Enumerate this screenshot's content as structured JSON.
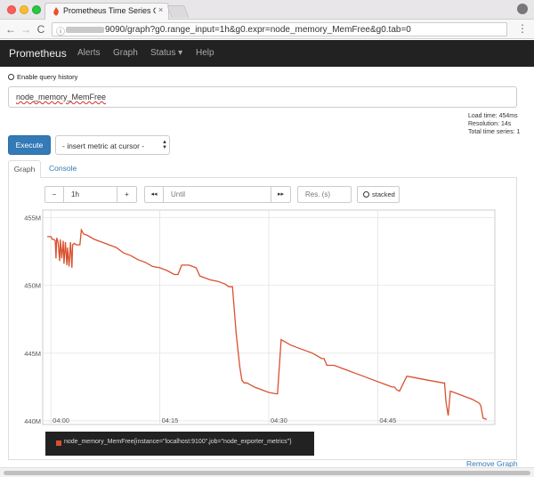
{
  "browser": {
    "tab_title": "Prometheus Time Series Colle",
    "url": "9090/graph?g0.range_input=1h&g0.expr=node_memory_MemFree&g0.tab=0",
    "back_glyph": "←",
    "forward_glyph": "→",
    "reload_glyph": "C",
    "info_glyph": "ⓘ",
    "star_glyph": "☆",
    "menu_glyph": "⋮",
    "close_glyph": "×"
  },
  "navbar": {
    "brand": "Prometheus",
    "links": [
      "Alerts",
      "Graph",
      "Status ▾",
      "Help"
    ]
  },
  "query": {
    "history_label": "Enable query history",
    "expression": "node_memory_MemFree",
    "load_time": "Load time: 454ms",
    "resolution": "Resolution: 14s",
    "total_series": "Total time series: 1",
    "execute_label": "Execute",
    "metric_select": "- insert metric at cursor -"
  },
  "tabs": {
    "graph": "Graph",
    "console": "Console"
  },
  "controls": {
    "minus": "−",
    "range": "1h",
    "plus": "+",
    "back": "◂◂",
    "until_placeholder": "Until",
    "forward": "▸▸",
    "resolution_placeholder": "Res. (s)",
    "stacked": "stacked"
  },
  "chart_data": {
    "type": "line",
    "x_tick_labels": [
      "04:00",
      "04:15",
      "04:30",
      "04:45"
    ],
    "y_tick_labels": [
      "440M",
      "445M",
      "450M",
      "455M"
    ],
    "ylim": [
      439.8,
      455.5
    ],
    "grid": true,
    "series": [
      {
        "name": "node_memory_MemFree{instance=\"localhost:9100\",job=\"node_exporter_metrics\"}",
        "color": "#d9502f",
        "x_minutes": [
          -0.5,
          0,
          0.2,
          0.4,
          0.6,
          0.7,
          0.8,
          1.0,
          1.2,
          1.3,
          1.5,
          1.7,
          1.8,
          2.0,
          2.2,
          2.3,
          2.5,
          2.7,
          2.9,
          3.0,
          3.2,
          3.5,
          4.0,
          4.2,
          4.5,
          5.0,
          6,
          7,
          8,
          9,
          10,
          11,
          12,
          13,
          14,
          15,
          16,
          17,
          17.5,
          18,
          19,
          19.5,
          20,
          20.5,
          21,
          22,
          23,
          24,
          24.5,
          25,
          25.5,
          26,
          26.3,
          26.6,
          27,
          28,
          29,
          30,
          31,
          31.2,
          31.7,
          32,
          33,
          34,
          35,
          36,
          37,
          37.3,
          37.6,
          38,
          39,
          40,
          41,
          42,
          43,
          44,
          45,
          46,
          47,
          47.3,
          47.6,
          48,
          49,
          50,
          51,
          52,
          53,
          54,
          54.2,
          54.4,
          54.7,
          55,
          56,
          57,
          58,
          59,
          59.2,
          59.5,
          60
        ],
        "values": [
          453.6,
          453.6,
          453.4,
          453.4,
          453.3,
          452.0,
          453.5,
          453.2,
          451.8,
          453.4,
          452.0,
          453.3,
          451.6,
          453.2,
          451.5,
          452.8,
          451.4,
          453.2,
          451.3,
          453.0,
          453.1,
          453.0,
          453.0,
          454.1,
          453.8,
          453.7,
          453.4,
          453.2,
          453.0,
          452.8,
          452.4,
          452.2,
          451.9,
          451.7,
          451.4,
          451.3,
          451.1,
          450.8,
          450.8,
          451.5,
          451.5,
          451.4,
          451.3,
          450.7,
          450.6,
          450.4,
          450.3,
          450.1,
          449.9,
          449.9,
          446.5,
          444.0,
          443.0,
          442.8,
          442.8,
          442.5,
          442.3,
          442.1,
          442.0,
          442.0,
          446.0,
          445.9,
          445.6,
          445.4,
          445.2,
          445.0,
          444.7,
          444.6,
          444.6,
          444.1,
          444.1,
          443.9,
          443.7,
          443.5,
          443.3,
          443.1,
          442.9,
          442.7,
          442.5,
          442.5,
          442.3,
          442.2,
          443.3,
          443.2,
          443.1,
          443.0,
          442.9,
          442.8,
          442.8,
          441.4,
          440.4,
          442.2,
          442.0,
          441.8,
          441.6,
          441.3,
          441.1,
          440.2,
          440.1
        ]
      }
    ]
  },
  "legend": {
    "label": "node_memory_MemFree{instance=\"localhost:9100\",job=\"node_exporter_metrics\"}"
  },
  "footer": {
    "remove_graph": "Remove Graph"
  }
}
